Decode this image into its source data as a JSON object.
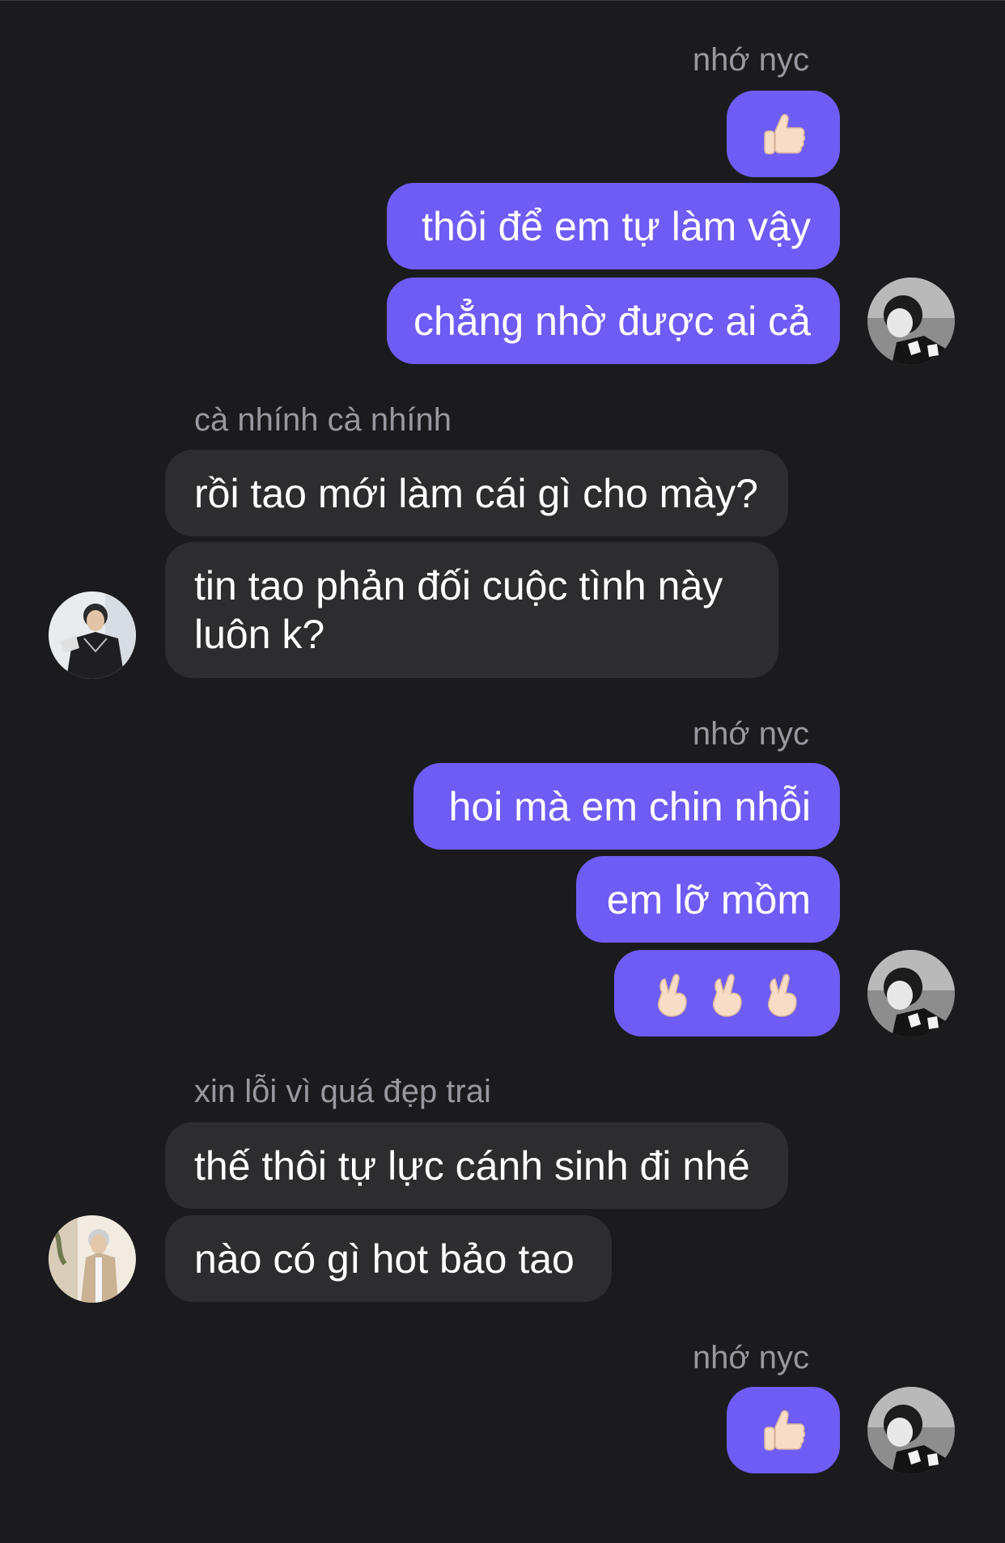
{
  "thread": {
    "groups": [
      {
        "side": "out",
        "sender": "nhớ nyc",
        "messages": [
          "👍",
          "thôi để em tự làm vậy",
          "chẳng nhờ được ai cả"
        ]
      },
      {
        "side": "in",
        "sender": "cà nhính cà nhính",
        "messages": [
          "rồi tao mới làm cái gì cho mày?",
          "tin tao phản đối cuộc tình này luôn k?"
        ]
      },
      {
        "side": "out",
        "sender": "nhớ nyc",
        "messages": [
          "hoi mà em chin nhỗi",
          "em lỡ mồm",
          "🫰🫰🫰"
        ]
      },
      {
        "side": "in",
        "sender": "xin lỗi vì quá đẹp trai",
        "messages": [
          "thế thôi tự lực cánh sinh đi nhé",
          "nào có gì hot bảo tao"
        ]
      },
      {
        "side": "out",
        "sender": "nhớ nyc",
        "messages": [
          "👍"
        ]
      }
    ]
  },
  "colors": {
    "background": "#1b1b1d",
    "outgoing_bubble": "#6f5cf4",
    "incoming_bubble": "#2d2d30",
    "sender_name": "#98989f"
  },
  "icons": {
    "thumbs_up": "thumbs-up-emoji",
    "finger_heart": "finger-heart-emoji"
  }
}
